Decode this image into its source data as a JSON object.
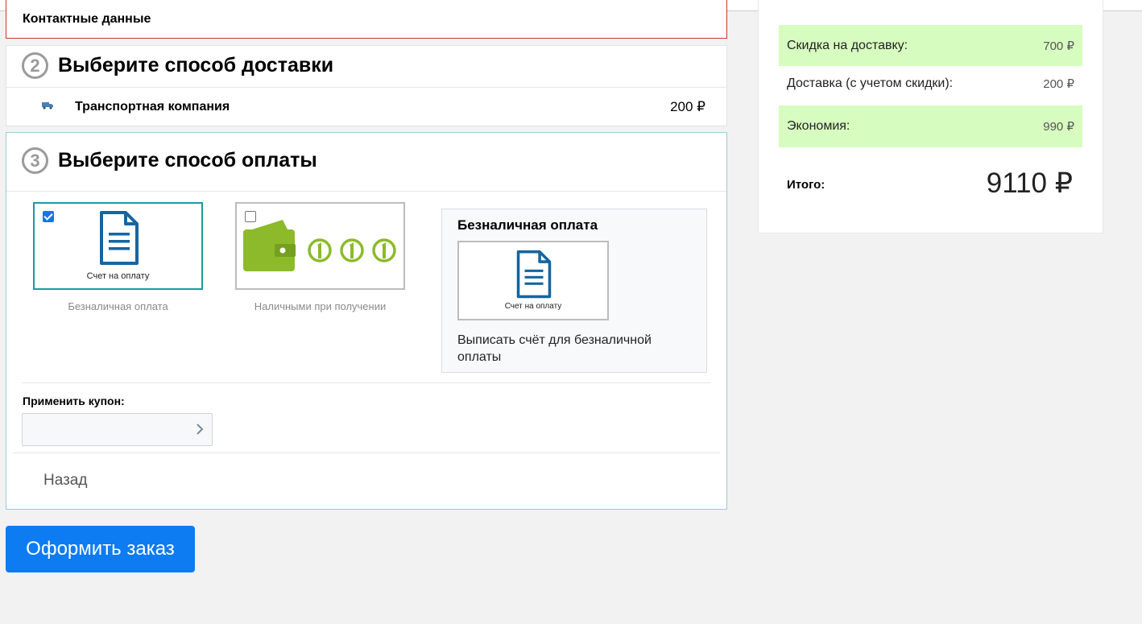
{
  "contact": {
    "title": "Контактные данные"
  },
  "delivery": {
    "step": "2",
    "title": "Выберите способ доставки",
    "method_name": "Транспортная компания",
    "method_price": "200 ₽"
  },
  "payment": {
    "step": "3",
    "title": "Выберите способ оплаты",
    "options": [
      {
        "label": "Безналичная оплата",
        "image_text": "Счет на оплату",
        "checked": true
      },
      {
        "label": "Наличными при получении",
        "checked": false
      }
    ],
    "selected_panel": {
      "title": "Безналичная оплата",
      "image_text": "Счет на оплату",
      "description": "Выписать счёт для безналичной оплаты"
    },
    "coupon_label": "Применить купон:",
    "coupon_value": "",
    "back_label": "Назад"
  },
  "submit_label": "Оформить заказ",
  "summary": {
    "rows": [
      {
        "label": "Скидка на доставку:",
        "value": "700 ₽"
      },
      {
        "label": "Доставка (с учетом скидки):",
        "value": "200 ₽"
      },
      {
        "label": "Экономия:",
        "value": "990 ₽"
      }
    ],
    "total_label": "Итого:",
    "total_value": "9110 ₽"
  },
  "colors": {
    "accent_blue": "#0d7cf2",
    "highlight_green": "#d7fcbf",
    "doc_icon": "#1565a0",
    "wallet_green": "#8cba2b",
    "error_border": "#d0342c"
  }
}
